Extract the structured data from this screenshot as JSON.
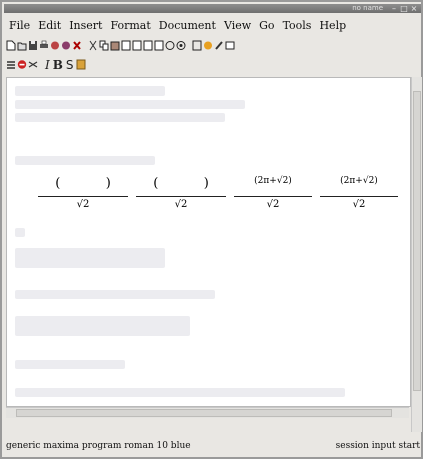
{
  "window": {
    "title": "no name",
    "controls": [
      "–",
      "□",
      "×"
    ]
  },
  "menubar": [
    "File",
    "Edit",
    "Insert",
    "Format",
    "Document",
    "View",
    "Go",
    "Tools",
    "Help"
  ],
  "toolbar_row1": [
    "new-icon",
    "open-icon",
    "save-icon",
    "print-icon",
    "export-icon",
    "preview-icon",
    "close-icon",
    "cut-icon",
    "copy-icon",
    "paste-icon",
    "undo-icon",
    "redo-icon",
    "find-icon",
    "replace-icon",
    "help-icon",
    "fullscreen-icon",
    "color-icon",
    "draw-icon",
    "window-icon"
  ],
  "toolbar_row2": {
    "icons": [
      "style-icon",
      "stop-icon",
      "shuffle-icon"
    ],
    "italic": "I",
    "bold": "B",
    "sans": "S",
    "image_icon": "image-icon"
  },
  "formula": {
    "terms": [
      {
        "num": "(           )",
        "den": "√2"
      },
      {
        "num": "(           )",
        "den": "√2"
      },
      {
        "num": "(2π+√2)",
        "den": "√2"
      },
      {
        "num": "(2π+√2)",
        "den": "√2"
      }
    ]
  },
  "statusbar": {
    "left": "generic maxima program roman 10 blue",
    "right": "session input start"
  }
}
